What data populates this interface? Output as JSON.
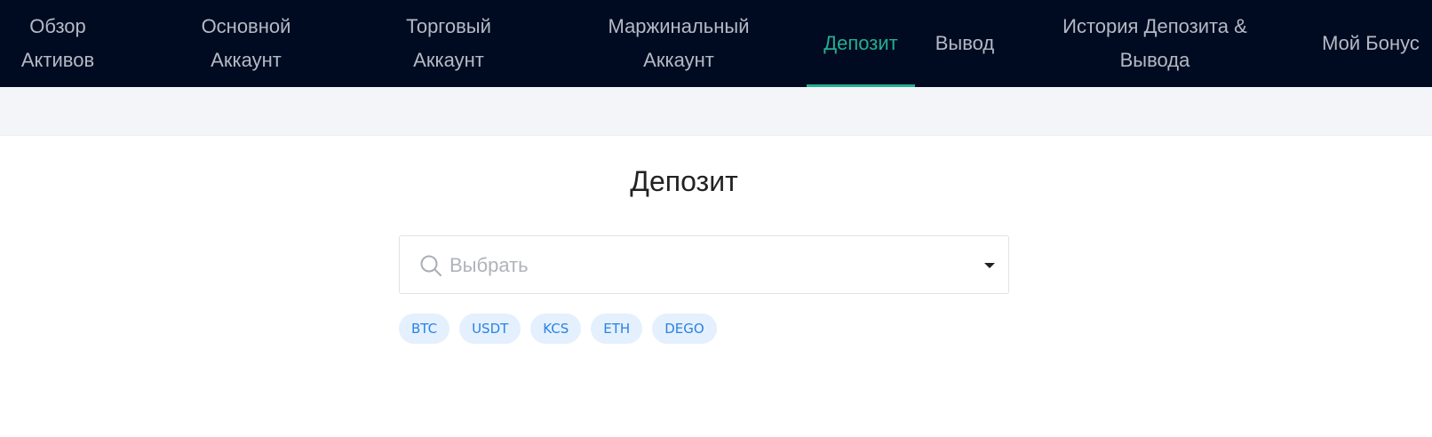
{
  "nav": {
    "items": [
      {
        "lines": [
          "Обзор",
          "Активов"
        ]
      },
      {
        "lines": [
          "Основной",
          "Аккаунт"
        ]
      },
      {
        "lines": [
          "Торговый",
          "Аккаунт"
        ]
      },
      {
        "lines": [
          "Маржинальный",
          "Аккаунт"
        ]
      },
      {
        "lines": [
          "Депозит",
          ""
        ]
      },
      {
        "lines": [
          "Вывод",
          ""
        ]
      },
      {
        "lines": [
          "История Депозита &",
          "Вывода"
        ]
      },
      {
        "lines": [
          "Мой Бонус",
          ""
        ]
      }
    ],
    "active_index": 4,
    "active_color": "#24ae8f",
    "background": "#000b21"
  },
  "page": {
    "title": "Депозит"
  },
  "select": {
    "placeholder": "Выбрать",
    "icon": "search-icon",
    "caret": "caret-down-icon"
  },
  "chips": [
    "BTC",
    "USDT",
    "KCS",
    "ETH",
    "DEGO"
  ]
}
